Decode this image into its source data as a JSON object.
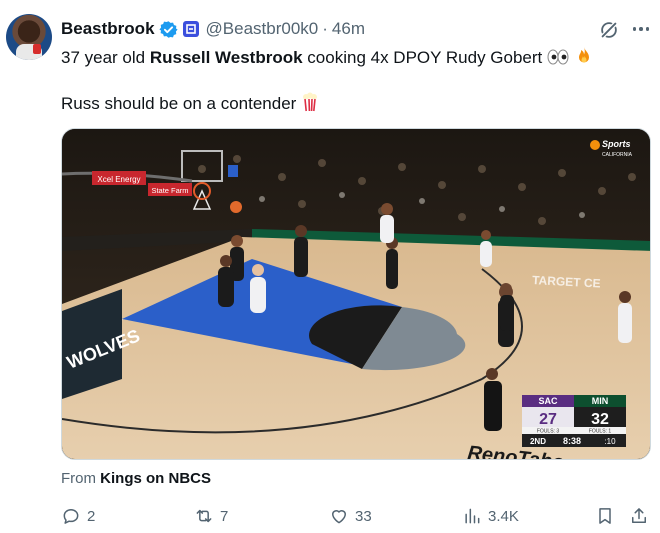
{
  "author": {
    "display_name": "Beastbrook",
    "handle": "@Beastbr00k0",
    "separator": "·",
    "time": "46m"
  },
  "tweet": {
    "line1_pre": "37 year old ",
    "line1_bold": "Russell Westbrook",
    "line1_post": " cooking 4x DPOY Rudy Gobert ",
    "line2": "Russ should be on a contender "
  },
  "media": {
    "network_logo": "Sports",
    "network_sub": "CALIFORNIA",
    "ad_1": "Xcel Energy",
    "ad_2": "State Farm",
    "court_text": "TARGET CE",
    "baseline_text": "WOLVES",
    "sponsor": "RenoTahoe",
    "scoreboard": {
      "away_team": "SAC",
      "away_score": "27",
      "away_fouls": "FOULS: 3",
      "home_team": "MIN",
      "home_score": "32",
      "home_fouls": "FOULS: 1",
      "quarter": "2ND",
      "clock": "8:38",
      "shot_clock": ":10"
    }
  },
  "source": {
    "prefix": "From ",
    "name": "Kings on NBCS"
  },
  "actions": {
    "replies": "2",
    "reposts": "7",
    "likes": "33",
    "views": "3.4K"
  },
  "colors": {
    "accent": "#1d9bf0",
    "muted": "#536471",
    "kings_purple": "#5a2d81",
    "wolves_blue": "#2b5fc9"
  }
}
